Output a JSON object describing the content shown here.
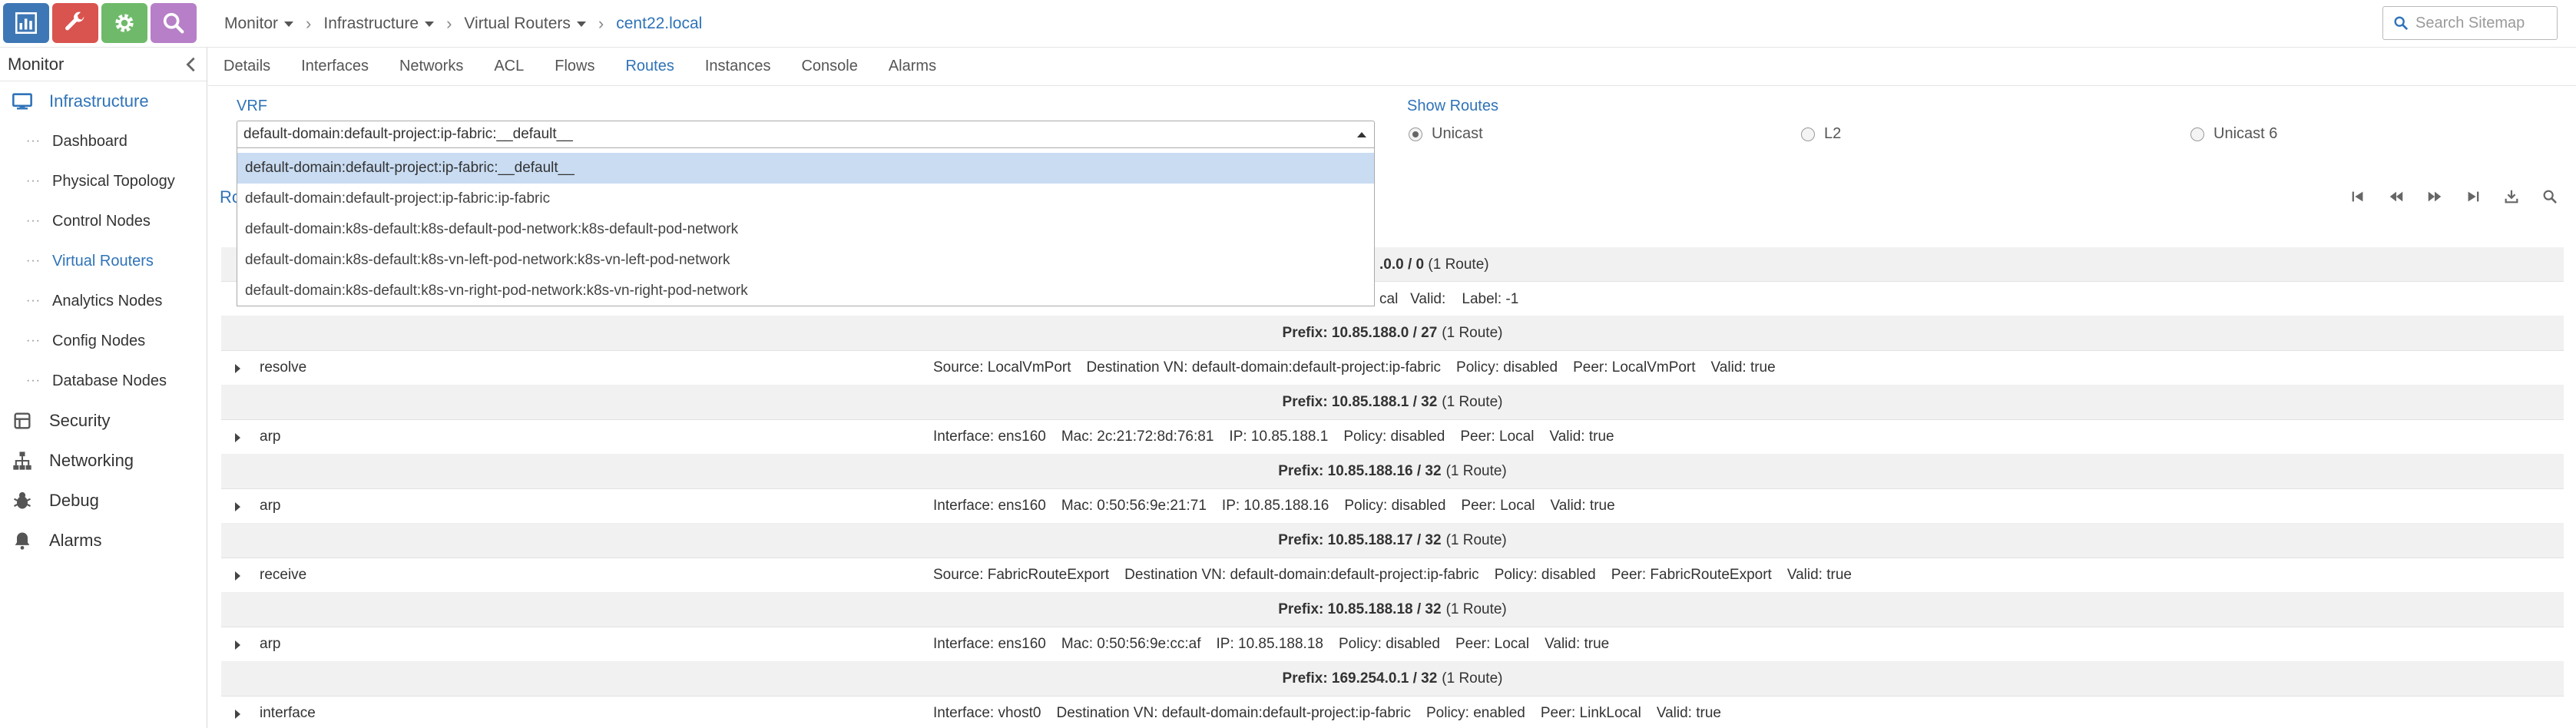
{
  "toolbar": {
    "buttons": [
      {
        "name": "monitor",
        "icon": "bar-chart-icon",
        "color": "#3e77b5"
      },
      {
        "name": "configure",
        "icon": "wrench-icon",
        "color": "#d9534f"
      },
      {
        "name": "settings",
        "icon": "gear-icon",
        "color": "#6fba6a"
      },
      {
        "name": "query",
        "icon": "search-icon",
        "color": "#b67fc7"
      }
    ]
  },
  "breadcrumb": {
    "items": [
      "Monitor",
      "Infrastructure",
      "Virtual Routers"
    ],
    "current": "cent22.local"
  },
  "search": {
    "placeholder": "Search Sitemap"
  },
  "sidebar": {
    "title": "Monitor",
    "sections": [
      {
        "label": "Infrastructure",
        "icon": "monitor-icon",
        "active": true
      },
      {
        "label": "Security",
        "icon": "security-icon"
      },
      {
        "label": "Networking",
        "icon": "network-icon"
      },
      {
        "label": "Debug",
        "icon": "bug-icon"
      },
      {
        "label": "Alarms",
        "icon": "bell-icon"
      }
    ],
    "sub_items": [
      "Dashboard",
      "Physical Topology",
      "Control Nodes",
      "Virtual Routers",
      "Analytics Nodes",
      "Config Nodes",
      "Database Nodes"
    ],
    "active_sub_item": "Virtual Routers"
  },
  "tabs": [
    "Details",
    "Interfaces",
    "Networks",
    "ACL",
    "Flows",
    "Routes",
    "Instances",
    "Console",
    "Alarms"
  ],
  "active_tab": "Routes",
  "vrf": {
    "label": "VRF",
    "selected": "default-domain:default-project:ip-fabric:__default__",
    "options": [
      "default-domain:default-project:ip-fabric:__default__",
      "default-domain:default-project:ip-fabric:ip-fabric",
      "default-domain:k8s-default:k8s-default-pod-network:k8s-default-pod-network",
      "default-domain:k8s-default:k8s-vn-left-pod-network:k8s-vn-left-pod-network",
      "default-domain:k8s-default:k8s-vn-right-pod-network:k8s-vn-right-pod-network"
    ]
  },
  "show_routes": {
    "label": "Show Routes",
    "options": [
      "Unicast",
      "L2",
      "Unicast 6"
    ],
    "selected": "Unicast"
  },
  "grid": {
    "title_fragment": "Ro",
    "toolbar_icons": [
      "first-page-icon",
      "previous-page-icon",
      "next-page-icon",
      "last-page-icon",
      "download-icon",
      "search-icon"
    ],
    "hidden_prefix_fragment": ".0.0 / 0",
    "hidden_prefix_count": "(1 Route)",
    "hidden_route_fragment": [
      "cal",
      "Valid:",
      "Label: -1"
    ],
    "rows": [
      {
        "kind": "prefix",
        "prefix": "Prefix: 10.85.188.0 / 27",
        "count": "(1 Route)"
      },
      {
        "kind": "route",
        "type": "resolve",
        "fields": [
          "Source: LocalVmPort",
          "Destination VN: default-domain:default-project:ip-fabric",
          "Policy: disabled",
          "Peer: LocalVmPort",
          "Valid: true"
        ]
      },
      {
        "kind": "prefix",
        "prefix": "Prefix: 10.85.188.1 / 32",
        "count": "(1 Route)"
      },
      {
        "kind": "route",
        "type": "arp",
        "fields": [
          "Interface: ens160",
          "Mac: 2c:21:72:8d:76:81",
          "IP: 10.85.188.1",
          "Policy: disabled",
          "Peer: Local",
          "Valid: true"
        ]
      },
      {
        "kind": "prefix",
        "prefix": "Prefix: 10.85.188.16 / 32",
        "count": "(1 Route)"
      },
      {
        "kind": "route",
        "type": "arp",
        "fields": [
          "Interface: ens160",
          "Mac: 0:50:56:9e:21:71",
          "IP: 10.85.188.16",
          "Policy: disabled",
          "Peer: Local",
          "Valid: true"
        ]
      },
      {
        "kind": "prefix",
        "prefix": "Prefix: 10.85.188.17 / 32",
        "count": "(1 Route)"
      },
      {
        "kind": "route",
        "type": "receive",
        "fields": [
          "Source: FabricRouteExport",
          "Destination VN: default-domain:default-project:ip-fabric",
          "Policy: disabled",
          "Peer: FabricRouteExport",
          "Valid: true"
        ]
      },
      {
        "kind": "prefix",
        "prefix": "Prefix: 10.85.188.18 / 32",
        "count": "(1 Route)"
      },
      {
        "kind": "route",
        "type": "arp",
        "fields": [
          "Interface: ens160",
          "Mac: 0:50:56:9e:cc:af",
          "IP: 10.85.188.18",
          "Policy: disabled",
          "Peer: Local",
          "Valid: true"
        ]
      },
      {
        "kind": "prefix",
        "prefix": "Prefix: 169.254.0.1 / 32",
        "count": "(1 Route)"
      },
      {
        "kind": "route",
        "type": "interface",
        "fields": [
          "Interface: vhost0",
          "Destination VN: default-domain:default-project:ip-fabric",
          "Policy: enabled",
          "Peer: LinkLocal",
          "Valid: true"
        ]
      }
    ]
  }
}
